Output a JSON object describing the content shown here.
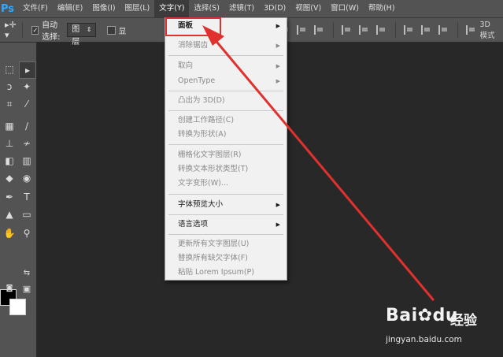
{
  "app": {
    "logo": "Ps",
    "colors": {
      "menubar": "#535353",
      "canvas": "#282828",
      "dropdown": "#f1f1f1",
      "highlight": "#e0312f"
    }
  },
  "menubar": {
    "items": [
      {
        "label": "文件(F)"
      },
      {
        "label": "编辑(E)"
      },
      {
        "label": "图像(I)"
      },
      {
        "label": "图层(L)"
      },
      {
        "label": "文字(Y)"
      },
      {
        "label": "选择(S)"
      },
      {
        "label": "滤镜(T)"
      },
      {
        "label": "3D(D)"
      },
      {
        "label": "视图(V)"
      },
      {
        "label": "窗口(W)"
      },
      {
        "label": "帮助(H)"
      }
    ],
    "active_index": 4
  },
  "options": {
    "auto_select_label": "自动选择:",
    "auto_select_checked": true,
    "layer_select_value": "图层",
    "show_label": "显",
    "mode_3d": "3D 模式"
  },
  "type_menu": {
    "items": [
      {
        "label": "面板",
        "submenu": true,
        "disabled": false
      },
      {
        "label": "消除锯齿",
        "submenu": true,
        "disabled": true
      },
      {
        "label": "取向",
        "submenu": true,
        "disabled": true
      },
      {
        "label": "OpenType",
        "submenu": true,
        "disabled": true
      },
      {
        "label": "凸出为 3D(D)",
        "submenu": false,
        "disabled": true
      },
      {
        "label": "创建工作路径(C)",
        "submenu": false,
        "disabled": true
      },
      {
        "label": "转换为形状(A)",
        "submenu": false,
        "disabled": true
      },
      {
        "label": "栅格化文字图层(R)",
        "submenu": false,
        "disabled": true
      },
      {
        "label": "转换文本形状类型(T)",
        "submenu": false,
        "disabled": true
      },
      {
        "label": "文字变形(W)...",
        "submenu": false,
        "disabled": true
      },
      {
        "label": "字体预览大小",
        "submenu": true,
        "disabled": false
      },
      {
        "label": "语言选项",
        "submenu": true,
        "disabled": false
      },
      {
        "label": "更新所有文字图层(U)",
        "submenu": false,
        "disabled": true
      },
      {
        "label": "替换所有缺欠字体(F)",
        "submenu": false,
        "disabled": true
      },
      {
        "label": "粘贴 Lorem Ipsum(P)",
        "submenu": false,
        "disabled": true
      }
    ]
  },
  "watermark": {
    "brand": "Bai",
    "brand_end": "du",
    "suffix": "经验",
    "url": "jingyan.baidu.com"
  }
}
